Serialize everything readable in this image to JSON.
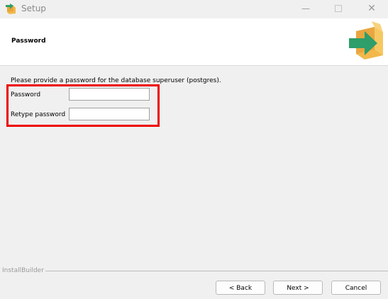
{
  "window": {
    "title": "Setup",
    "title_icon": "installer-box-icon",
    "minimize_glyph": "—",
    "close_glyph": "✕"
  },
  "header": {
    "title": "Password",
    "logo_icon": "installer-box-arrow-icon"
  },
  "main": {
    "instructions": "Please provide a password for the database superuser (postgres).",
    "password_label": "Password",
    "password_value": "",
    "retype_label": "Retype password",
    "retype_value": "",
    "highlight_color": "#ee0000"
  },
  "footer": {
    "brand": "InstallBuilder",
    "back_label": "< Back",
    "next_label": "Next >",
    "cancel_label": "Cancel"
  },
  "colors": {
    "background": "#f0f0f0",
    "header_background": "#ffffff",
    "logo_green": "#2e9e6a",
    "logo_box": "#f2b84b"
  }
}
